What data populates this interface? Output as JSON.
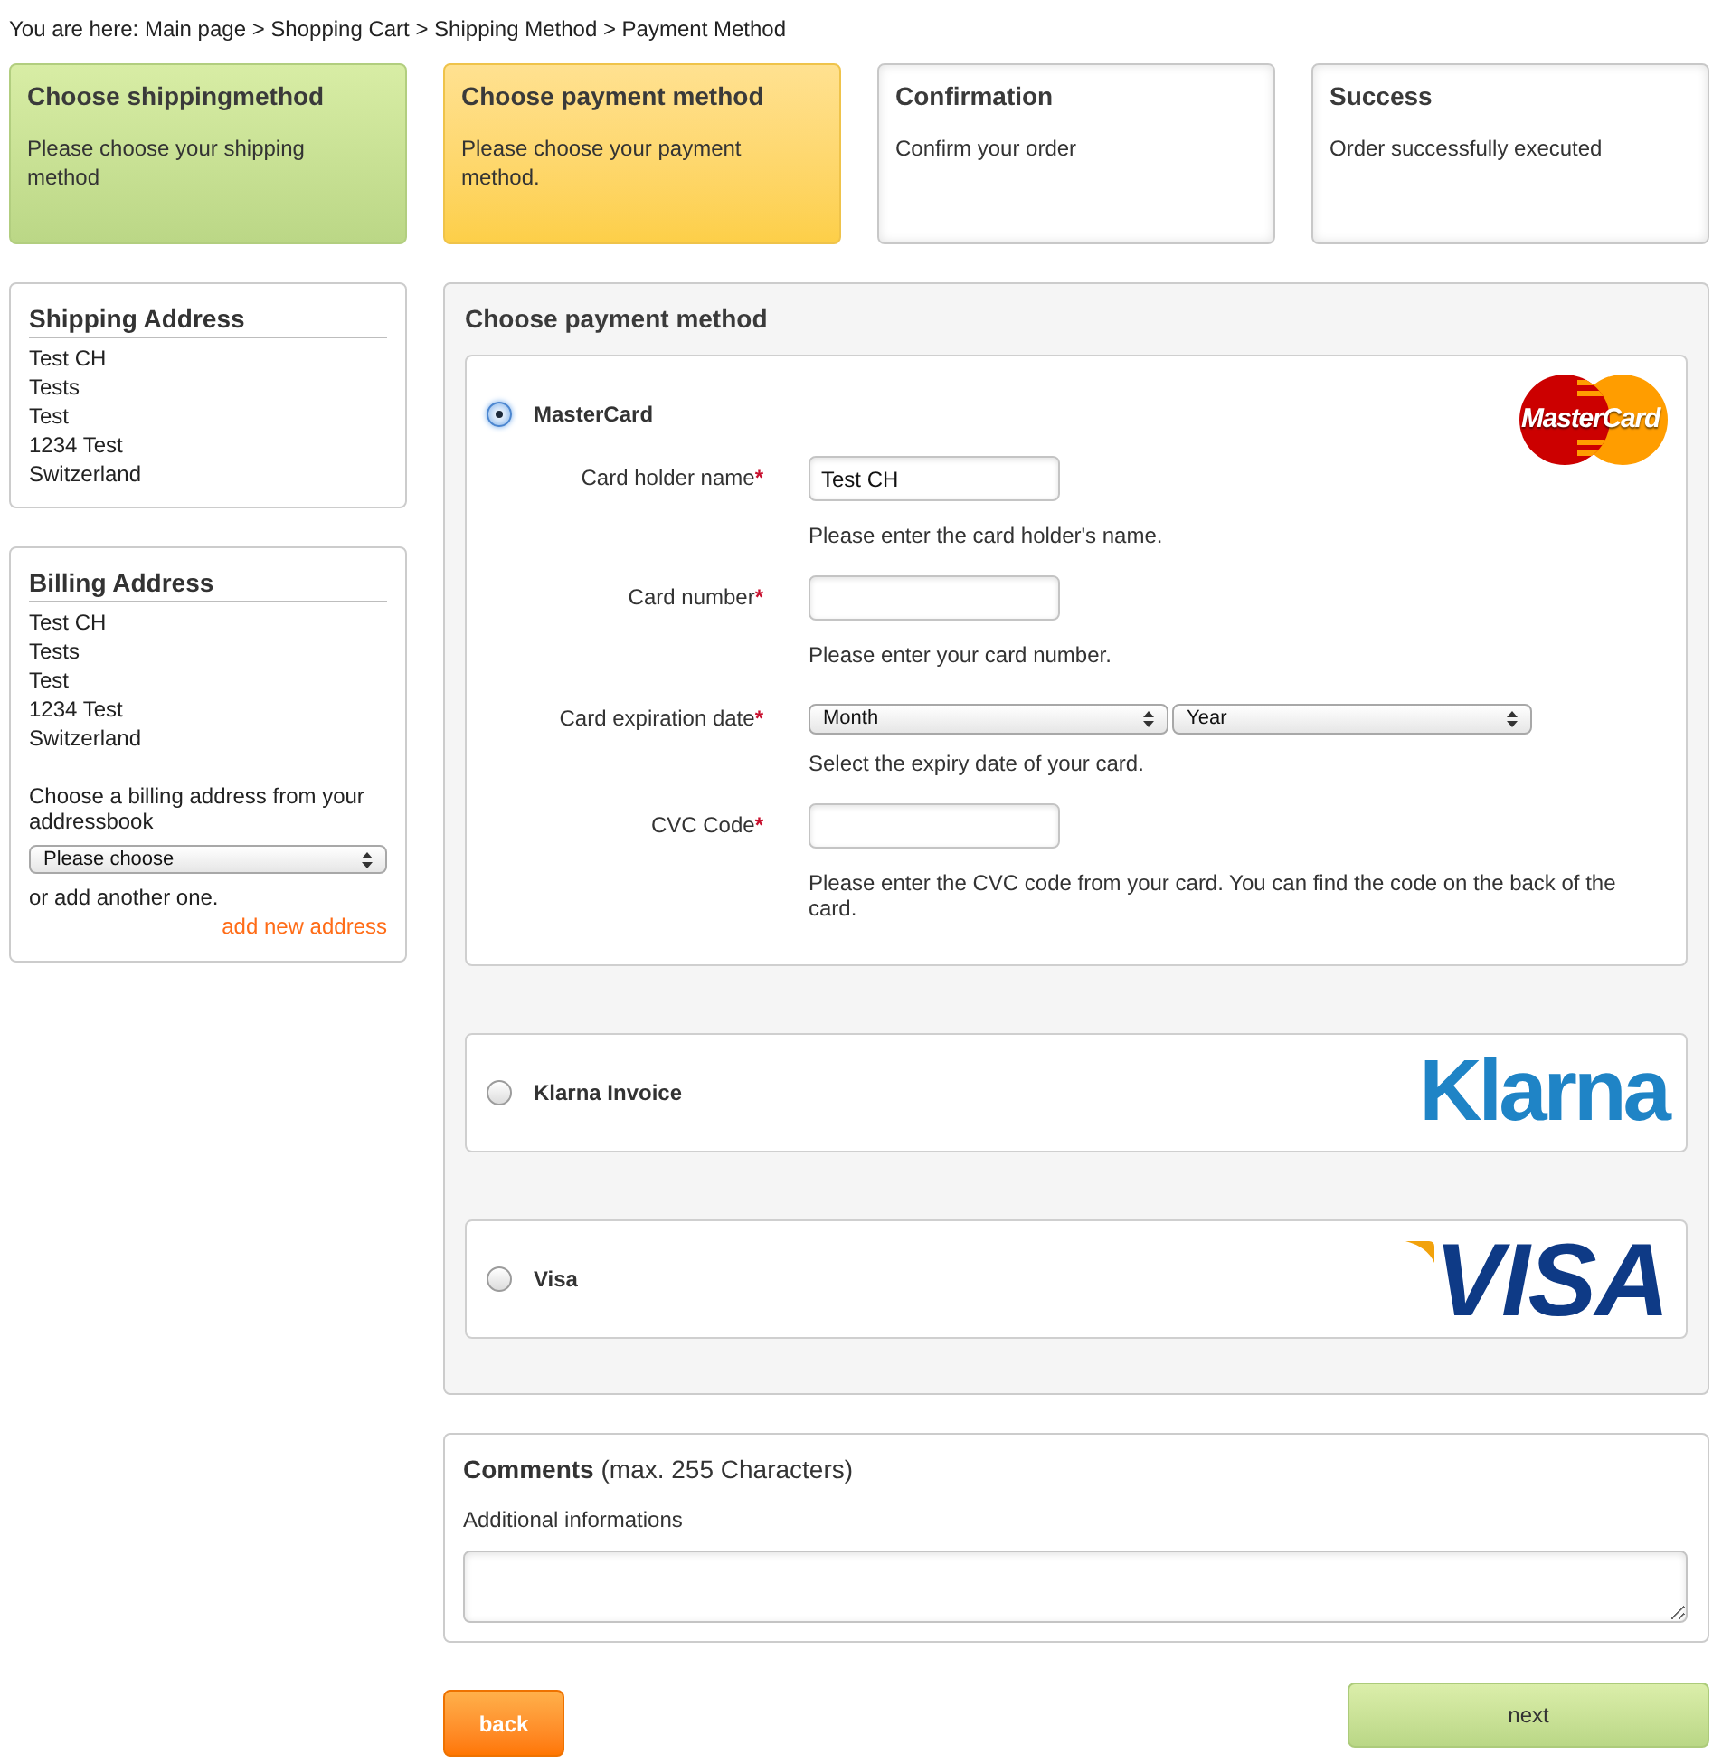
{
  "breadcrumb": "You are here: Main page > Shopping Cart > Shipping Method > Payment Method",
  "steps": [
    {
      "title": "Choose shippingmethod",
      "text": "Please choose your shipping method",
      "done": true,
      "selected": false
    },
    {
      "title": "Choose payment method",
      "text": "Please choose your payment method.",
      "done": false,
      "selected": true
    },
    {
      "title": "Confirmation",
      "text": "Confirm your order",
      "done": false,
      "selected": false
    },
    {
      "title": "Success",
      "text": "Order successfully executed",
      "done": false,
      "selected": false
    }
  ],
  "shipping_address": {
    "title": "Shipping Address",
    "lines": [
      "Test CH",
      "Tests",
      "Test",
      "1234 Test",
      "Switzerland"
    ]
  },
  "billing_address": {
    "title": "Billing Address",
    "lines": [
      "Test CH",
      "Tests",
      "Test",
      "1234 Test",
      "Switzerland"
    ],
    "prompt": "Choose a billing address from your addressbook",
    "select": {
      "value": "Please choose"
    },
    "alternative": "or add another one.",
    "link": "add new address"
  },
  "payment": {
    "title": "Choose payment method",
    "methods": [
      {
        "label": "MasterCard",
        "selected": true,
        "logo": {
          "kind": "mastercard",
          "text": "MasterCard"
        },
        "fields": [
          {
            "kind": "text",
            "label": "Card holder name",
            "required_mark": "*",
            "value": "Test CH",
            "hint": "Please enter the card holder's name."
          },
          {
            "kind": "text",
            "label": "Card number",
            "required_mark": "*",
            "hint": "Please enter your card number."
          },
          {
            "kind": "selects",
            "label": "Card expiration date",
            "required_mark": "*",
            "selects": [
              {
                "value": "Month"
              },
              {
                "value": "Year"
              }
            ],
            "hint": "Select the expiry date of your card."
          },
          {
            "kind": "text",
            "label": "CVC Code",
            "required_mark": "*",
            "hint": "Please enter the CVC code from your card. You can find the code on the back of the card."
          }
        ]
      },
      {
        "label": "Klarna Invoice",
        "selected": false,
        "logo": {
          "kind": "klarna",
          "text": "Klarna"
        }
      },
      {
        "label": "Visa",
        "selected": false,
        "logo": {
          "kind": "visa",
          "text": "VISA"
        }
      }
    ]
  },
  "comments": {
    "title": "**Comments** (max. 255 Characters)",
    "label": "Additional informations"
  },
  "buttons": [
    {
      "kind": "back",
      "label": "back"
    },
    {
      "kind": "next",
      "label": "next"
    }
  ]
}
